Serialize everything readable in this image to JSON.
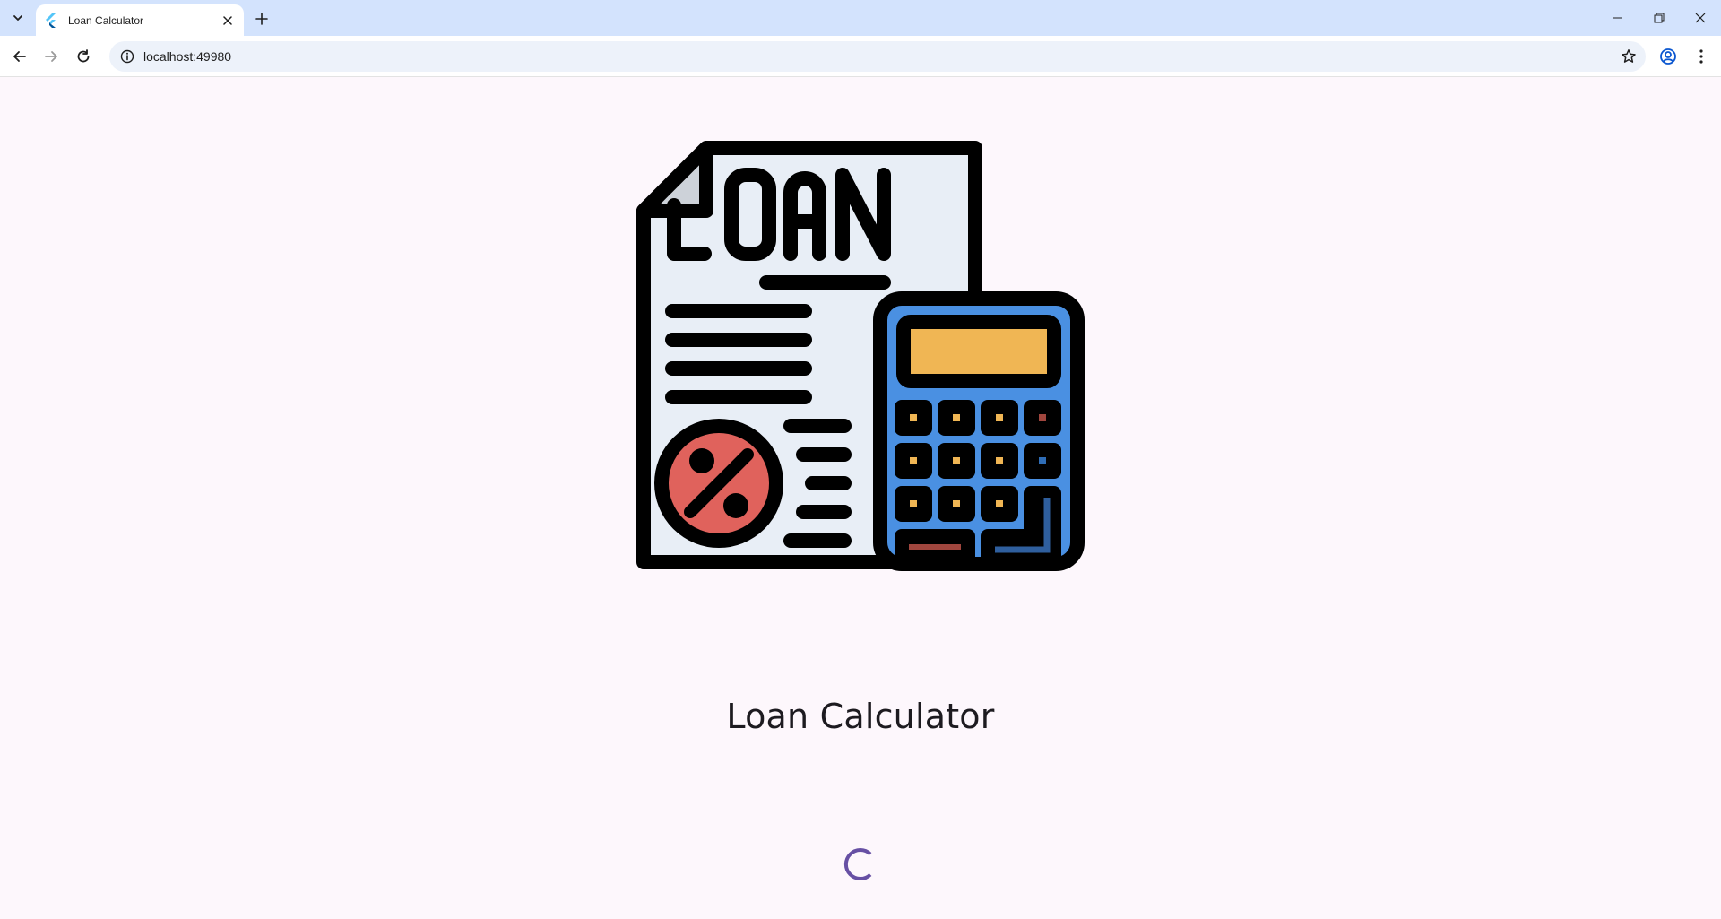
{
  "browser": {
    "tab": {
      "title": "Loan Calculator"
    },
    "address": {
      "url": "localhost:49980"
    }
  },
  "icons": {
    "tab_search": "chevron-down-icon",
    "favicon": "flutter-icon",
    "tab_close": "close-icon",
    "new_tab": "plus-icon",
    "back": "arrow-left-icon",
    "forward": "arrow-right-icon",
    "reload": "reload-icon",
    "site_info": "info-icon",
    "bookmark": "star-icon",
    "profile": "account-icon",
    "menu": "kebab-icon",
    "hero": "loan-document-calculator-icon"
  },
  "hero_image": {
    "word": "LOAN"
  },
  "page": {
    "title": "Loan Calculator",
    "loading": true
  },
  "colors": {
    "background": "#fdf7fc",
    "spinner": "#6750a4",
    "calculator_body": "#4a90e2",
    "calculator_screen": "#f0b654",
    "percent_badge": "#e0625c",
    "paper": "#e8eef6"
  }
}
